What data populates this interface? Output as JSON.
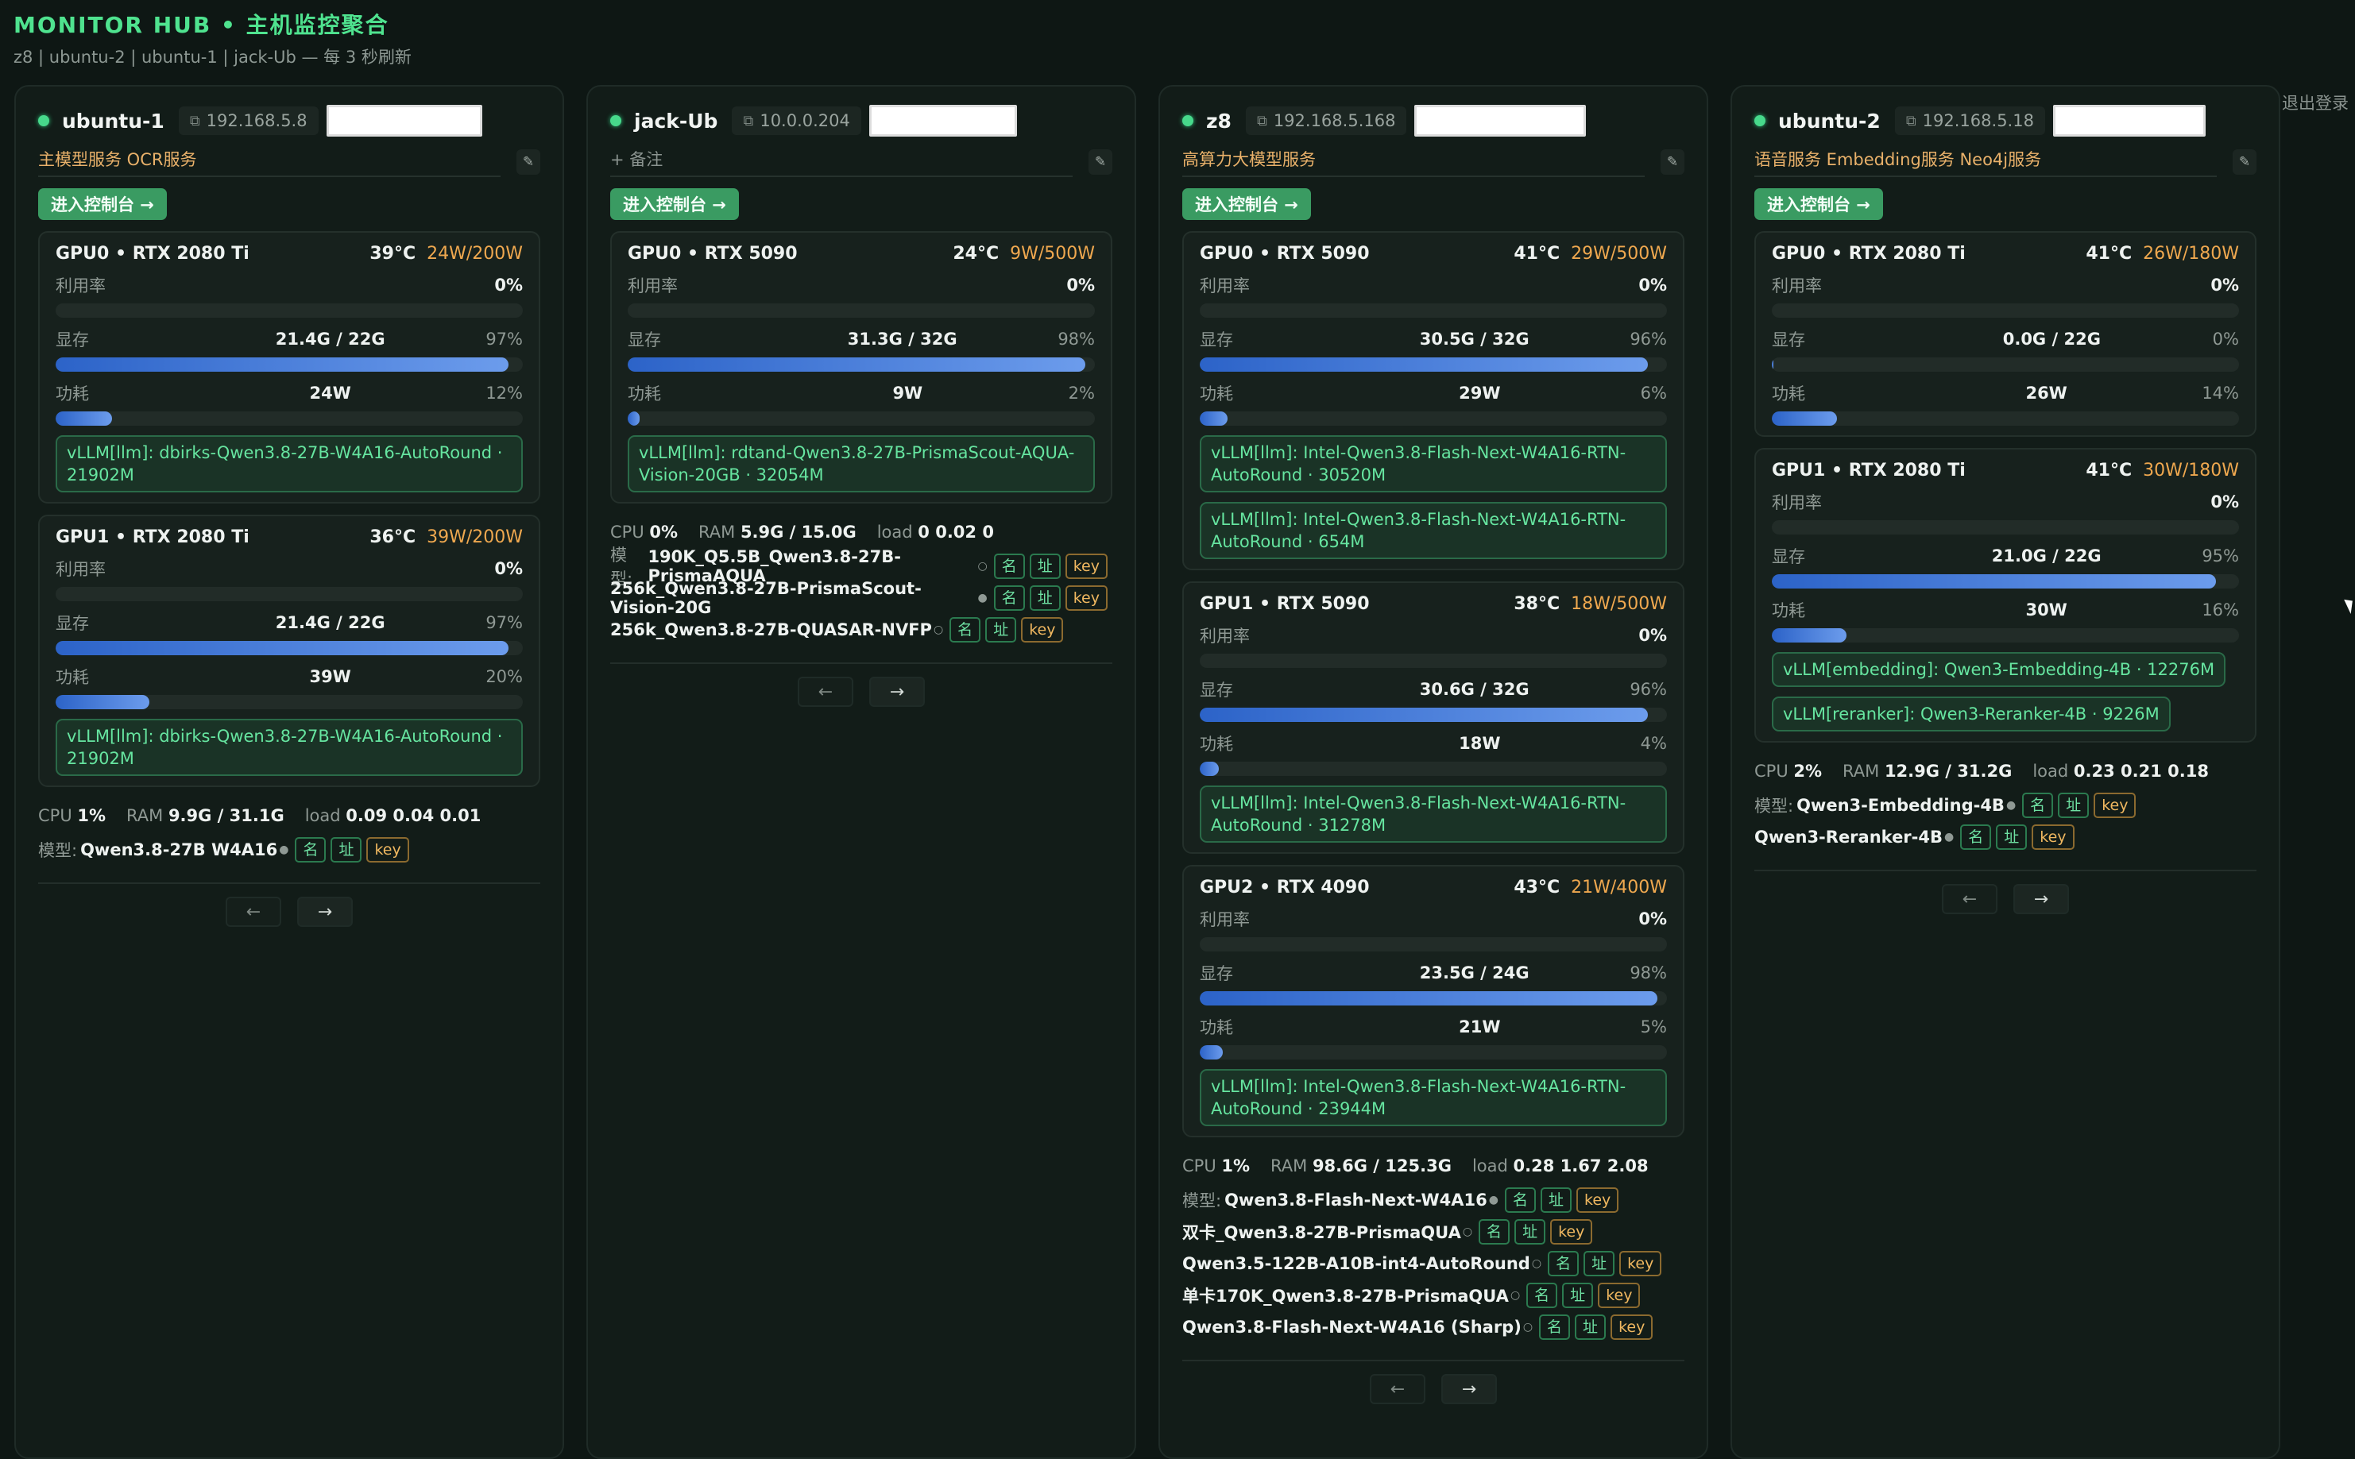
{
  "app": {
    "title": "MONITOR HUB • 主机监控聚合",
    "subtitle": "z8  |  ubuntu-2  |  ubuntu-1  |  jack-Ub — 每 3 秒刷新",
    "logout": "退出登录"
  },
  "labels": {
    "util": "利用率",
    "mem": "显存",
    "power": "功耗",
    "console": "进入控制台 →",
    "models_prefix": "模型:",
    "tag_name": "名",
    "tag_addr": "址",
    "tag_key": "key",
    "prev": "←",
    "next": "→",
    "edit": "✎"
  },
  "hosts": [
    {
      "name": "ubuntu-1",
      "ip": "192.168.5.8",
      "note": "主模型服务 OCR服务",
      "gpus": [
        {
          "name": "GPU0 • RTX 2080 Ti",
          "temp": "39°C",
          "power_cap": "24W/200W",
          "util": "0%",
          "mem": "21.4G / 22G",
          "mem_pct": "97%",
          "mem_frac": 0.97,
          "power": "24W",
          "power_pct": "12%",
          "power_frac": 0.12,
          "procs": [
            "vLLM[llm]: dbirks-Qwen3.8-27B-W4A16-AutoRound · 21902M"
          ]
        },
        {
          "name": "GPU1 • RTX 2080 Ti",
          "temp": "36°C",
          "power_cap": "39W/200W",
          "util": "0%",
          "mem": "21.4G / 22G",
          "mem_pct": "97%",
          "mem_frac": 0.97,
          "power": "39W",
          "power_pct": "20%",
          "power_frac": 0.2,
          "procs": [
            "vLLM[llm]: dbirks-Qwen3.8-27B-W4A16-AutoRound · 21902M"
          ]
        }
      ],
      "cpu": "1%",
      "ram": "9.9G / 31.1G",
      "load": "0.09 0.04 0.01",
      "models": [
        {
          "name": "Qwen3.8-27B W4A16",
          "mark": "●"
        }
      ]
    },
    {
      "name": "jack-Ub",
      "ip": "10.0.0.204",
      "note": "+ 备注",
      "gpus": [
        {
          "name": "GPU0 • RTX 5090",
          "temp": "24°C",
          "power_cap": "9W/500W",
          "util": "0%",
          "mem": "31.3G / 32G",
          "mem_pct": "98%",
          "mem_frac": 0.98,
          "power": "9W",
          "power_pct": "2%",
          "power_frac": 0.02,
          "procs": [
            "vLLM[llm]: rdtand-Qwen3.8-27B-PrismaScout-AQUA-Vision-20GB · 32054M"
          ]
        }
      ],
      "cpu": "0%",
      "ram": "5.9G / 15.0G",
      "load": "0 0.02 0",
      "models": [
        {
          "name": "190K_Q5.5B_Qwen3.8-27B-PrismaAQUA",
          "mark": "○"
        },
        {
          "name": "256k_Qwen3.8-27B-PrismaScout-Vision-20G",
          "mark": "●"
        },
        {
          "name": "256k_Qwen3.8-27B-QUASAR-NVFP",
          "mark": "○"
        }
      ]
    },
    {
      "name": "z8",
      "ip": "192.168.5.168",
      "note": "高算力大模型服务",
      "gpus": [
        {
          "name": "GPU0 • RTX 5090",
          "temp": "41°C",
          "power_cap": "29W/500W",
          "util": "0%",
          "mem": "30.5G / 32G",
          "mem_pct": "96%",
          "mem_frac": 0.96,
          "power": "29W",
          "power_pct": "6%",
          "power_frac": 0.06,
          "procs": [
            "vLLM[llm]: Intel-Qwen3.8-Flash-Next-W4A16-RTN-AutoRound · 30520M",
            "vLLM[llm]: Intel-Qwen3.8-Flash-Next-W4A16-RTN-AutoRound · 654M"
          ]
        },
        {
          "name": "GPU1 • RTX 5090",
          "temp": "38°C",
          "power_cap": "18W/500W",
          "util": "0%",
          "mem": "30.6G / 32G",
          "mem_pct": "96%",
          "mem_frac": 0.96,
          "power": "18W",
          "power_pct": "4%",
          "power_frac": 0.04,
          "procs": [
            "vLLM[llm]: Intel-Qwen3.8-Flash-Next-W4A16-RTN-AutoRound · 31278M"
          ]
        },
        {
          "name": "GPU2 • RTX 4090",
          "temp": "43°C",
          "power_cap": "21W/400W",
          "util": "0%",
          "mem": "23.5G / 24G",
          "mem_pct": "98%",
          "mem_frac": 0.98,
          "power": "21W",
          "power_pct": "5%",
          "power_frac": 0.05,
          "procs": [
            "vLLM[llm]: Intel-Qwen3.8-Flash-Next-W4A16-RTN-AutoRound · 23944M"
          ]
        }
      ],
      "cpu": "1%",
      "ram": "98.6G / 125.3G",
      "load": "0.28 1.67 2.08",
      "models": [
        {
          "name": "Qwen3.8-Flash-Next-W4A16",
          "mark": "●"
        },
        {
          "name": "双卡_Qwen3.8-27B-PrismaQUA",
          "mark": "○"
        },
        {
          "name": "Qwen3.5-122B-A10B-int4-AutoRound",
          "mark": "○"
        },
        {
          "name": "单卡170K_Qwen3.8-27B-PrismaQUA",
          "mark": "○"
        },
        {
          "name": "Qwen3.8-Flash-Next-W4A16 (Sharp)",
          "mark": "○"
        }
      ]
    },
    {
      "name": "ubuntu-2",
      "ip": "192.168.5.18",
      "note": "语音服务 Embedding服务 Neo4j服务",
      "gpus": [
        {
          "name": "GPU0 • RTX 2080 Ti",
          "temp": "41°C",
          "power_cap": "26W/180W",
          "util": "0%",
          "mem": "0.0G / 22G",
          "mem_pct": "0%",
          "mem_frac": 0.0,
          "power": "26W",
          "power_pct": "14%",
          "power_frac": 0.14,
          "procs": []
        },
        {
          "name": "GPU1 • RTX 2080 Ti",
          "temp": "41°C",
          "power_cap": "30W/180W",
          "util": "0%",
          "mem": "21.0G / 22G",
          "mem_pct": "95%",
          "mem_frac": 0.95,
          "power": "30W",
          "power_pct": "16%",
          "power_frac": 0.16,
          "procs": [
            "vLLM[embedding]: Qwen3-Embedding-4B · 12276M",
            "vLLM[reranker]: Qwen3-Reranker-4B · 9226M"
          ],
          "inline_procs": true
        }
      ],
      "cpu": "2%",
      "ram": "12.9G / 31.2G",
      "load": "0.23 0.21 0.18",
      "models": [
        {
          "name": "Qwen3-Embedding-4B",
          "mark": "●"
        },
        {
          "name": "Qwen3-Reranker-4B",
          "mark": "●"
        }
      ]
    }
  ],
  "colors": {
    "accent": "#4fe38f",
    "bar": "#4a7fdc",
    "warn": "#efa84f",
    "tag_key": "#f0b860"
  }
}
